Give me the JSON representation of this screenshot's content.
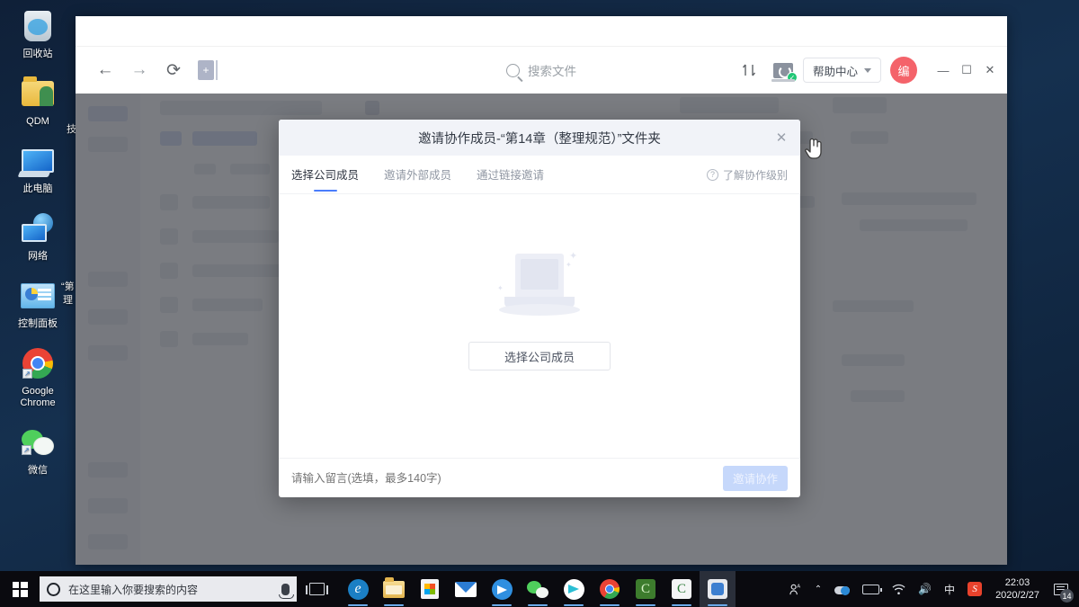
{
  "desktop": {
    "icons": [
      {
        "label": "回收站",
        "icon": "recycle-bin-icon",
        "shortcut": false
      },
      {
        "label": "QDM",
        "icon": "folder-user-icon",
        "shortcut": false
      },
      {
        "label": "此电脑",
        "icon": "this-pc-icon",
        "shortcut": false
      },
      {
        "label": "网络",
        "icon": "network-icon",
        "shortcut": false
      },
      {
        "label": "控制面板",
        "icon": "control-panel-icon",
        "shortcut": false
      },
      {
        "label": "Google\nChrome",
        "icon": "chrome-icon",
        "shortcut": true
      },
      {
        "label": "微信",
        "icon": "wechat-icon",
        "shortcut": true
      }
    ],
    "partial_labels": [
      "技",
      "“第",
      "理"
    ]
  },
  "browser": {
    "nav": {
      "back": "←",
      "forward": "→",
      "reload": "⟳",
      "new_tab": "+"
    },
    "search": {
      "placeholder": "搜索文件",
      "icon": "search-icon"
    },
    "toolbar_right": {
      "transfer_icon": "transfer-list-icon",
      "sync_icon": "sync-status-icon",
      "sync_badge": "✓",
      "help_label": "帮助中心",
      "avatar_text": "编"
    },
    "window_controls": {
      "minimize": "—",
      "maximize": "☐",
      "close": "✕"
    }
  },
  "modal": {
    "title": "邀请协作成员-“第14章（整理规范）”文件夹",
    "close": "✕",
    "tabs": [
      {
        "label": "选择公司成员",
        "active": true
      },
      {
        "label": "邀请外部成员",
        "active": false
      },
      {
        "label": "通过链接邀请",
        "active": false
      }
    ],
    "learn_link": {
      "label": "了解协作级别",
      "icon": "question-mark-icon",
      "glyph": "?"
    },
    "empty_state": {
      "illustration": "empty-laptop-illustration"
    },
    "select_member_button": "选择公司成员",
    "footer": {
      "message_placeholder": "请输入留言(选填，最多140字)",
      "message_value": "",
      "invite_button": "邀请协作",
      "invite_disabled": true
    },
    "colors": {
      "accent": "#4a7dfc",
      "header_bg": "#f1f3f8",
      "invite_disabled_bg": "#c6d8fb"
    }
  },
  "taskbar": {
    "start": "start-button",
    "search_placeholder": "在这里输入你要搜索的内容",
    "mic_icon": "microphone-icon",
    "task_view": "task-view-icon",
    "apps": [
      {
        "name": "microsoft-edge",
        "glyph": "e",
        "active": false
      },
      {
        "name": "file-explorer",
        "glyph": "",
        "active": false
      },
      {
        "name": "microsoft-store",
        "glyph": "",
        "active": false
      },
      {
        "name": "mail",
        "glyph": "",
        "active": false
      },
      {
        "name": "telegram-blue",
        "glyph": "",
        "active": false
      },
      {
        "name": "wechat",
        "glyph": "",
        "active": false
      },
      {
        "name": "telegram-teal",
        "glyph": "",
        "active": false
      },
      {
        "name": "google-chrome",
        "glyph": "",
        "active": false
      },
      {
        "name": "app-c-green",
        "glyph": "C",
        "active": false
      },
      {
        "name": "app-c-white",
        "glyph": "C",
        "active": false
      },
      {
        "name": "qdm-app",
        "glyph": "",
        "active": true
      }
    ],
    "tray": {
      "people_icon": "people-icon",
      "chevron": "⌃",
      "onedrive_icon": "onedrive-icon",
      "battery_icon": "battery-icon",
      "wifi_icon": "wifi-icon",
      "volume_icon": "🔊",
      "ime_label": "中",
      "sogou_label": "S",
      "time": "22:03",
      "date": "2020/2/27",
      "notification_count": "14"
    }
  }
}
